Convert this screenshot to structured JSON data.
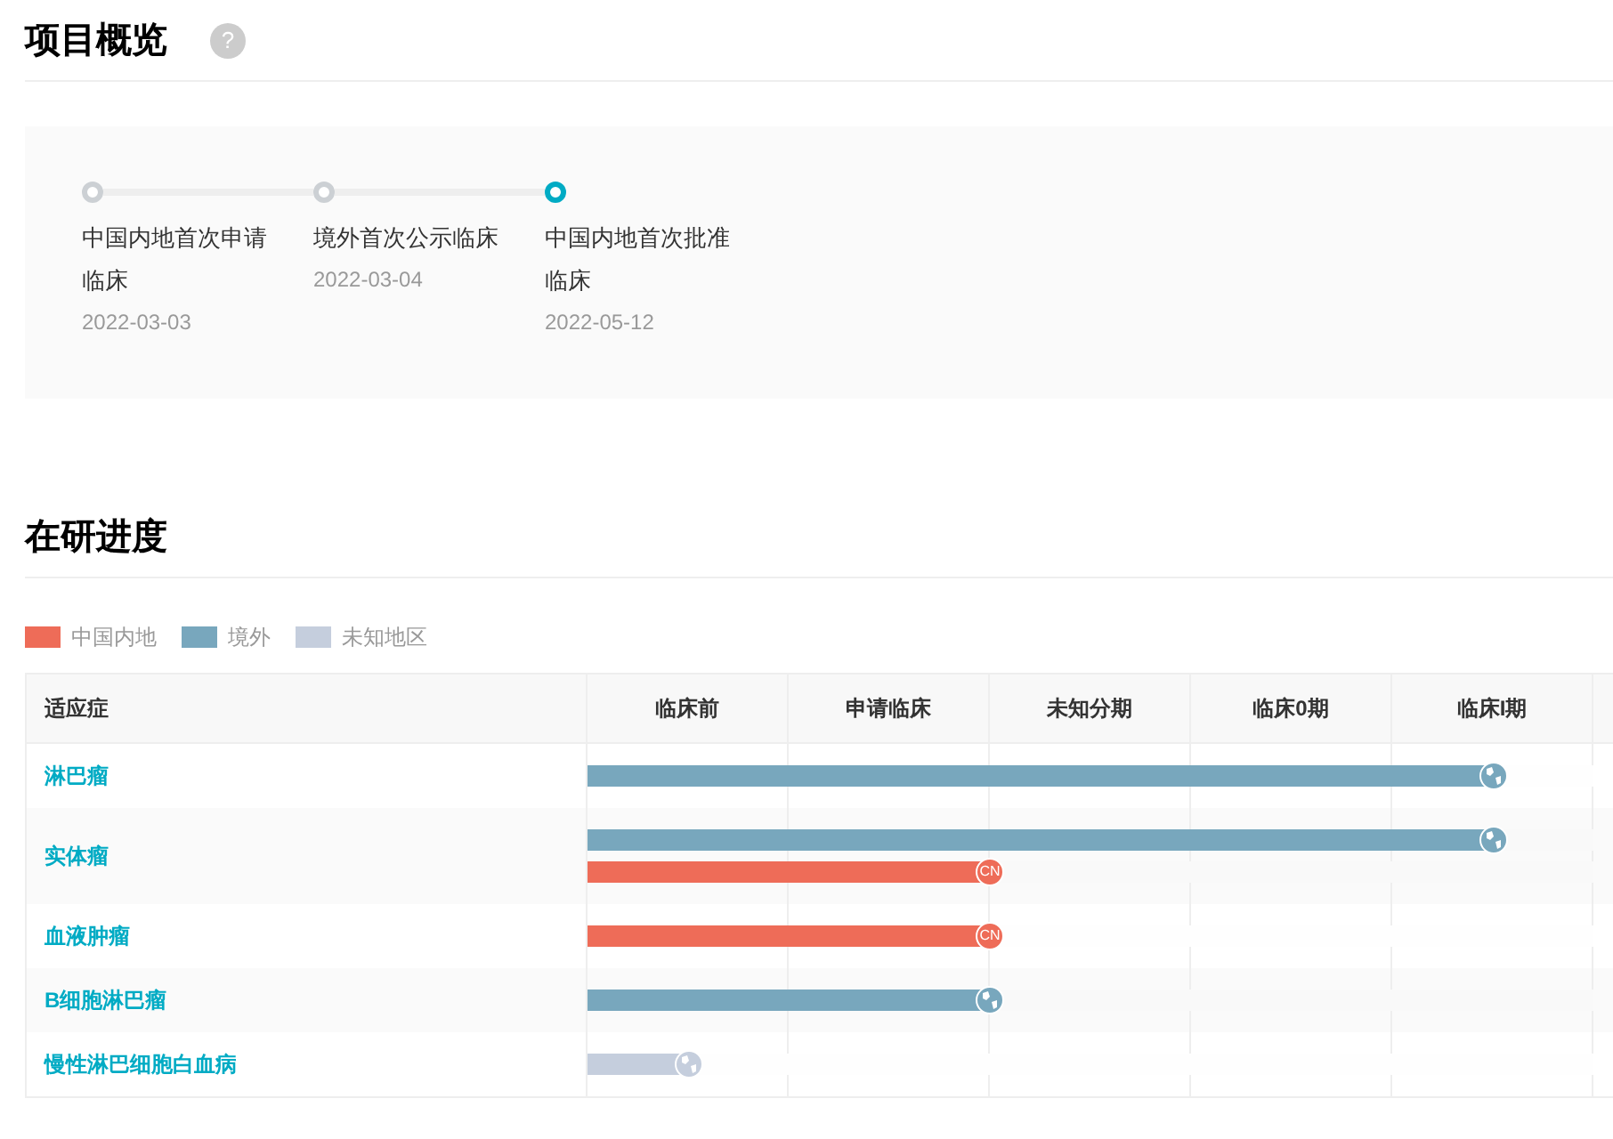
{
  "overview": {
    "title": "项目概览",
    "help": "?",
    "steps": [
      {
        "label": "中国内地首次申请临床",
        "date": "2022-03-03",
        "selected": false
      },
      {
        "label": "境外首次公示临床",
        "date": "2022-03-04",
        "selected": false
      },
      {
        "label": "中国内地首次批准临床",
        "date": "2022-05-12",
        "selected": true
      }
    ]
  },
  "progress": {
    "title": "在研进度",
    "legend": [
      {
        "label": "中国内地",
        "color": "#ee6c58"
      },
      {
        "label": "境外",
        "color": "#78a7bd"
      },
      {
        "label": "未知地区",
        "color": "#c5cedd"
      }
    ],
    "table": {
      "columns": [
        "适应症",
        "临床前",
        "申请临床",
        "未知分期",
        "临床0期",
        "临床I期"
      ],
      "rows": [
        {
          "name": "淋巴瘤",
          "bars": [
            {
              "kind": "global",
              "level": 0.9
            }
          ]
        },
        {
          "name": "实体瘤",
          "bars": [
            {
              "kind": "global",
              "level": 0.9
            },
            {
              "kind": "cn",
              "level": 0.4,
              "badge": "CN"
            }
          ]
        },
        {
          "name": "血液肿瘤",
          "bars": [
            {
              "kind": "cn",
              "level": 0.4,
              "badge": "CN"
            }
          ]
        },
        {
          "name": "B细胞淋巴瘤",
          "bars": [
            {
              "kind": "global",
              "level": 0.4
            }
          ]
        },
        {
          "name": "慢性淋巴细胞白血病",
          "bars": [
            {
              "kind": "unknown",
              "level": 0.1
            }
          ]
        }
      ]
    }
  }
}
